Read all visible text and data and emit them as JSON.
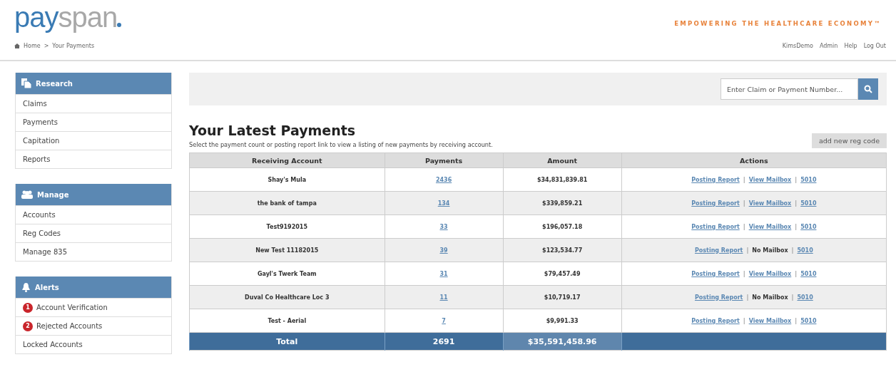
{
  "header": {
    "logo": {
      "part1": "pay",
      "part2": "span"
    },
    "tagline": "EMPOWERING THE HEALTHCARE ECONOMY™",
    "breadcrumb": [
      "Home",
      ">",
      "Your Payments"
    ],
    "user_links": [
      "KimsDemo",
      "Admin",
      "Help",
      "Log Out"
    ]
  },
  "sidebar": [
    {
      "title": "Research",
      "items": [
        {
          "label": "Claims"
        },
        {
          "label": "Payments"
        },
        {
          "label": "Capitation"
        },
        {
          "label": "Reports"
        }
      ]
    },
    {
      "title": "Manage",
      "items": [
        {
          "label": "Accounts"
        },
        {
          "label": "Reg Codes"
        },
        {
          "label": "Manage 835"
        }
      ]
    },
    {
      "title": "Alerts",
      "items": [
        {
          "label": "Account Verification",
          "badge": "1"
        },
        {
          "label": "Rejected Accounts",
          "badge": "2"
        },
        {
          "label": "Locked Accounts"
        }
      ]
    }
  ],
  "search": {
    "placeholder": "Enter Claim or Payment Number..."
  },
  "main": {
    "title": "Your Latest Payments",
    "subtitle": "Select the payment count or posting report link to view a listing of new payments by receiving account.",
    "add_button": "add new reg code"
  },
  "table": {
    "columns": [
      "Receiving Account",
      "Payments",
      "Amount",
      "Actions"
    ],
    "rows": [
      {
        "account": "Shay's Mula",
        "payments": "2436",
        "amount": "$34,831,839.81",
        "actions": [
          {
            "kind": "link",
            "text": "Posting Report"
          },
          {
            "kind": "separator",
            "text": "|"
          },
          {
            "kind": "link",
            "text": "View Mailbox"
          },
          {
            "kind": "separator",
            "text": "|"
          },
          {
            "kind": "link",
            "text": "5010"
          }
        ]
      },
      {
        "account": "the bank of tampa",
        "payments": "134",
        "amount": "$339,859.21",
        "actions": [
          {
            "kind": "link",
            "text": "Posting Report"
          },
          {
            "kind": "separator",
            "text": "|"
          },
          {
            "kind": "link",
            "text": "View Mailbox"
          },
          {
            "kind": "separator",
            "text": "|"
          },
          {
            "kind": "link",
            "text": "5010"
          }
        ]
      },
      {
        "account": "Test9192015",
        "payments": "33",
        "amount": "$196,057.18",
        "actions": [
          {
            "kind": "link",
            "text": "Posting Report"
          },
          {
            "kind": "separator",
            "text": "|"
          },
          {
            "kind": "link",
            "text": "View Mailbox"
          },
          {
            "kind": "separator",
            "text": "|"
          },
          {
            "kind": "link",
            "text": "5010"
          }
        ]
      },
      {
        "account": "New Test 11182015",
        "payments": "39",
        "amount": "$123,534.77",
        "actions": [
          {
            "kind": "link",
            "text": "Posting Report"
          },
          {
            "kind": "separator",
            "text": "|"
          },
          {
            "kind": "text",
            "text": "No Mailbox"
          },
          {
            "kind": "separator",
            "text": "|"
          },
          {
            "kind": "link",
            "text": "5010"
          }
        ]
      },
      {
        "account": "Gayl's Twerk Team",
        "payments": "31",
        "amount": "$79,457.49",
        "actions": [
          {
            "kind": "link",
            "text": "Posting Report"
          },
          {
            "kind": "separator",
            "text": "|"
          },
          {
            "kind": "link",
            "text": "View Mailbox"
          },
          {
            "kind": "separator",
            "text": "|"
          },
          {
            "kind": "link",
            "text": "5010"
          }
        ]
      },
      {
        "account": "Duval Co Healthcare Loc 3",
        "payments": "11",
        "amount": "$10,719.17",
        "actions": [
          {
            "kind": "link",
            "text": "Posting Report"
          },
          {
            "kind": "separator",
            "text": "|"
          },
          {
            "kind": "text",
            "text": "No Mailbox"
          },
          {
            "kind": "separator",
            "text": "|"
          },
          {
            "kind": "link",
            "text": "5010"
          }
        ]
      },
      {
        "account": "Test - Aerial",
        "payments": "7",
        "amount": "$9,991.33",
        "actions": [
          {
            "kind": "link",
            "text": "Posting Report"
          },
          {
            "kind": "separator",
            "text": "|"
          },
          {
            "kind": "link",
            "text": "View Mailbox"
          },
          {
            "kind": "separator",
            "text": "|"
          },
          {
            "kind": "link",
            "text": "5010"
          }
        ]
      }
    ],
    "total": {
      "label": "Total",
      "payments": "2691",
      "amount": "$35,591,458.96"
    }
  }
}
